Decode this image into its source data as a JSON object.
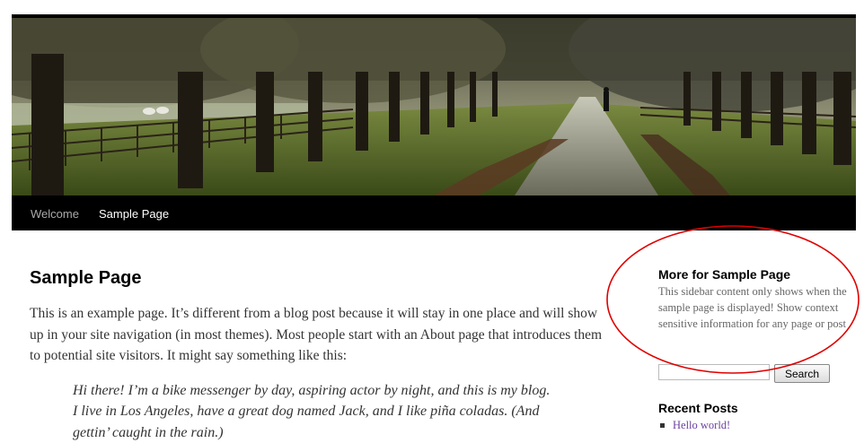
{
  "header": {
    "image_alt": "Tree-lined avenue header photo"
  },
  "nav": {
    "items": [
      {
        "label": "Welcome",
        "current": false
      },
      {
        "label": "Sample Page",
        "current": true
      }
    ]
  },
  "main": {
    "title": "Sample Page",
    "paragraph": "This is an example page. It’s different from a blog post because it will stay in one place and will show up in your site navigation (in most themes). Most people start with an About page that introduces them to potential site visitors. It might say something like this:",
    "quote": "Hi there! I’m a bike messenger by day, aspiring actor by night, and this is my blog. I live in Los Angeles, have a great dog named Jack, and I like piña coladas. (And gettin’ caught in the rain.)"
  },
  "sidebar": {
    "widget": {
      "title": "More for Sample Page",
      "text": "This sidebar content only shows when the sample page is displayed! Show context sensitive information for any page or post"
    },
    "search": {
      "value": "",
      "button_label": "Search"
    },
    "recent_posts": {
      "title": "Recent Posts",
      "items": [
        "Hello world!"
      ]
    }
  },
  "colors": {
    "nav_bg": "#000000",
    "nav_text": "#aaaaaa",
    "nav_current_text": "#ffffff",
    "link": "#6b3fa0",
    "annotation": "#e00000"
  }
}
